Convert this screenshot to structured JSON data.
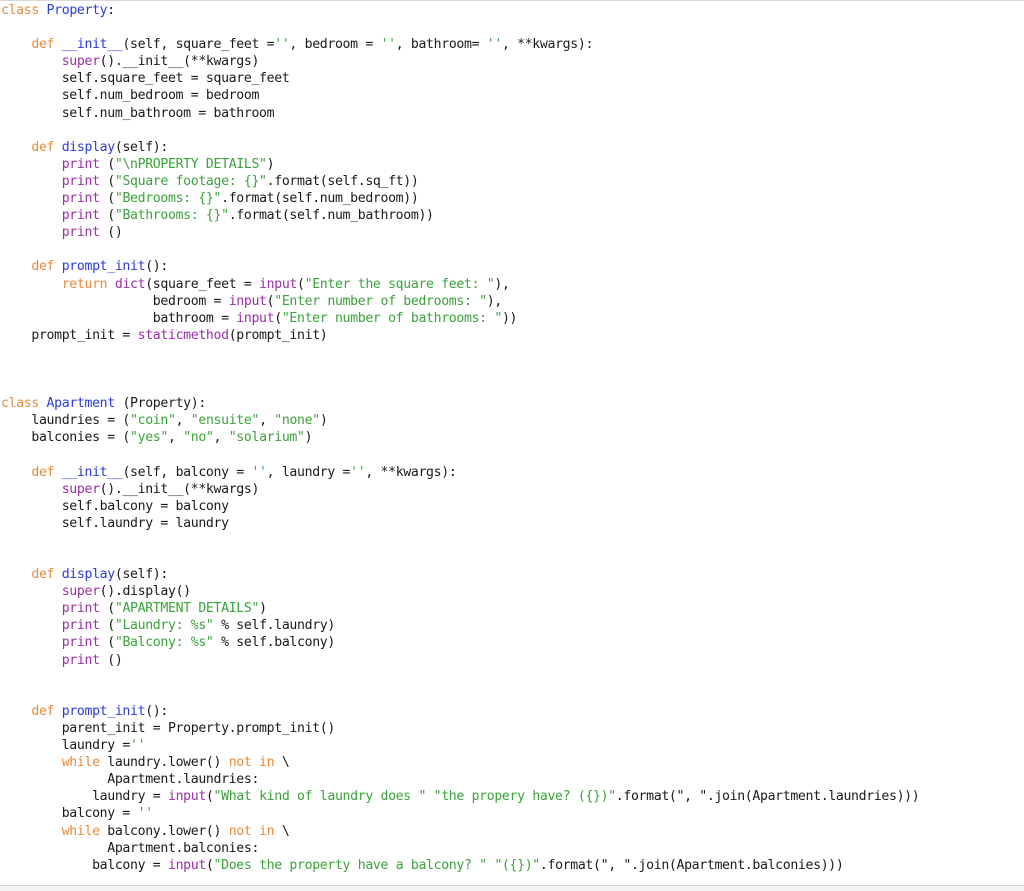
{
  "editor": {
    "language": "python",
    "colors": {
      "keyword": "#e88a3c",
      "function_name": "#2a3bd6",
      "builtin": "#9a2fa8",
      "string": "#3aa33a",
      "text": "#1a1a1a",
      "background": "#ffffff"
    },
    "lines": [
      [
        [
          "kw",
          "class "
        ],
        [
          "fn",
          "Property"
        ],
        [
          "tx",
          ":"
        ]
      ],
      [],
      [
        [
          "tx",
          "    "
        ],
        [
          "kw",
          "def "
        ],
        [
          "fn",
          "__init__"
        ],
        [
          "tx",
          "(self, square_feet ="
        ],
        [
          "st",
          "''"
        ],
        [
          "tx",
          ", bedroom = "
        ],
        [
          "st",
          "''"
        ],
        [
          "tx",
          ", bathroom= "
        ],
        [
          "st",
          "''"
        ],
        [
          "tx",
          ", **kwargs):"
        ]
      ],
      [
        [
          "tx",
          "        "
        ],
        [
          "bi",
          "super"
        ],
        [
          "tx",
          "().__init__(**kwargs)"
        ]
      ],
      [
        [
          "tx",
          "        self.square_feet = square_feet"
        ]
      ],
      [
        [
          "tx",
          "        self.num_bedroom = bedroom"
        ]
      ],
      [
        [
          "tx",
          "        self.num_bathroom = bathroom"
        ]
      ],
      [],
      [
        [
          "tx",
          "    "
        ],
        [
          "kw",
          "def "
        ],
        [
          "fn",
          "display"
        ],
        [
          "tx",
          "(self):"
        ]
      ],
      [
        [
          "tx",
          "        "
        ],
        [
          "bi",
          "print"
        ],
        [
          "tx",
          " ("
        ],
        [
          "st",
          "\"\\nPROPERTY DETAILS\""
        ],
        [
          "tx",
          ")"
        ]
      ],
      [
        [
          "tx",
          "        "
        ],
        [
          "bi",
          "print"
        ],
        [
          "tx",
          " ("
        ],
        [
          "st",
          "\"Square footage: {}\""
        ],
        [
          "tx",
          ".format(self.sq_ft))"
        ]
      ],
      [
        [
          "tx",
          "        "
        ],
        [
          "bi",
          "print"
        ],
        [
          "tx",
          " ("
        ],
        [
          "st",
          "\"Bedrooms: {}\""
        ],
        [
          "tx",
          ".format(self.num_bedroom))"
        ]
      ],
      [
        [
          "tx",
          "        "
        ],
        [
          "bi",
          "print"
        ],
        [
          "tx",
          " ("
        ],
        [
          "st",
          "\"Bathrooms: {}\""
        ],
        [
          "tx",
          ".format(self.num_bathroom))"
        ]
      ],
      [
        [
          "tx",
          "        "
        ],
        [
          "bi",
          "print"
        ],
        [
          "tx",
          " ()"
        ]
      ],
      [],
      [
        [
          "tx",
          "    "
        ],
        [
          "kw",
          "def "
        ],
        [
          "fn",
          "prompt_init"
        ],
        [
          "tx",
          "():"
        ]
      ],
      [
        [
          "tx",
          "        "
        ],
        [
          "kw",
          "return "
        ],
        [
          "bi",
          "dict"
        ],
        [
          "tx",
          "(square_feet = "
        ],
        [
          "bi",
          "input"
        ],
        [
          "tx",
          "("
        ],
        [
          "st",
          "\"Enter the square feet: \""
        ],
        [
          "tx",
          "),"
        ]
      ],
      [
        [
          "tx",
          "                    bedroom = "
        ],
        [
          "bi",
          "input"
        ],
        [
          "tx",
          "("
        ],
        [
          "st",
          "\"Enter number of bedrooms: \""
        ],
        [
          "tx",
          "),"
        ]
      ],
      [
        [
          "tx",
          "                    bathroom = "
        ],
        [
          "bi",
          "input"
        ],
        [
          "tx",
          "("
        ],
        [
          "st",
          "\"Enter number of bathrooms: \""
        ],
        [
          "tx",
          "))"
        ]
      ],
      [
        [
          "tx",
          "    prompt_init = "
        ],
        [
          "bi",
          "staticmethod"
        ],
        [
          "tx",
          "(prompt_init)"
        ]
      ],
      [],
      [],
      [],
      [
        [
          "kw",
          "class "
        ],
        [
          "fn",
          "Apartment"
        ],
        [
          "tx",
          " (Property):"
        ]
      ],
      [
        [
          "tx",
          "    laundries = ("
        ],
        [
          "st",
          "\"coin\""
        ],
        [
          "tx",
          ", "
        ],
        [
          "st",
          "\"ensuite\""
        ],
        [
          "tx",
          ", "
        ],
        [
          "st",
          "\"none\""
        ],
        [
          "tx",
          ")"
        ]
      ],
      [
        [
          "tx",
          "    balconies = ("
        ],
        [
          "st",
          "\"yes\""
        ],
        [
          "tx",
          ", "
        ],
        [
          "st",
          "\"no\""
        ],
        [
          "tx",
          ", "
        ],
        [
          "st",
          "\"solarium\""
        ],
        [
          "tx",
          ")"
        ]
      ],
      [],
      [
        [
          "tx",
          "    "
        ],
        [
          "kw",
          "def "
        ],
        [
          "fn",
          "__init__"
        ],
        [
          "tx",
          "(self, balcony = "
        ],
        [
          "st",
          "''"
        ],
        [
          "tx",
          ", laundry ="
        ],
        [
          "st",
          "''"
        ],
        [
          "tx",
          ", **kwargs):"
        ]
      ],
      [
        [
          "tx",
          "        "
        ],
        [
          "bi",
          "super"
        ],
        [
          "tx",
          "().__init__(**kwargs)"
        ]
      ],
      [
        [
          "tx",
          "        self.balcony = balcony"
        ]
      ],
      [
        [
          "tx",
          "        self.laundry = laundry"
        ]
      ],
      [],
      [],
      [
        [
          "tx",
          "    "
        ],
        [
          "kw",
          "def "
        ],
        [
          "fn",
          "display"
        ],
        [
          "tx",
          "(self):"
        ]
      ],
      [
        [
          "tx",
          "        "
        ],
        [
          "bi",
          "super"
        ],
        [
          "tx",
          "().display()"
        ]
      ],
      [
        [
          "tx",
          "        "
        ],
        [
          "bi",
          "print"
        ],
        [
          "tx",
          " ("
        ],
        [
          "st",
          "\"APARTMENT DETAILS\""
        ],
        [
          "tx",
          ")"
        ]
      ],
      [
        [
          "tx",
          "        "
        ],
        [
          "bi",
          "print"
        ],
        [
          "tx",
          " ("
        ],
        [
          "st",
          "\"Laundry: %s\""
        ],
        [
          "tx",
          " % self.laundry)"
        ]
      ],
      [
        [
          "tx",
          "        "
        ],
        [
          "bi",
          "print"
        ],
        [
          "tx",
          " ("
        ],
        [
          "st",
          "\"Balcony: %s\""
        ],
        [
          "tx",
          " % self.balcony)"
        ]
      ],
      [
        [
          "tx",
          "        "
        ],
        [
          "bi",
          "print"
        ],
        [
          "tx",
          " ()"
        ]
      ],
      [],
      [],
      [
        [
          "tx",
          "    "
        ],
        [
          "kw",
          "def "
        ],
        [
          "fn",
          "prompt_init"
        ],
        [
          "tx",
          "():"
        ]
      ],
      [
        [
          "tx",
          "        parent_init = Property.prompt_init()"
        ]
      ],
      [
        [
          "tx",
          "        laundry ="
        ],
        [
          "st",
          "''"
        ]
      ],
      [
        [
          "tx",
          "        "
        ],
        [
          "kw",
          "while"
        ],
        [
          "tx",
          " laundry.lower() "
        ],
        [
          "kw",
          "not in"
        ],
        [
          "tx",
          " \\"
        ]
      ],
      [
        [
          "tx",
          "              Apartment.laundries:"
        ]
      ],
      [
        [
          "tx",
          "            laundry = "
        ],
        [
          "bi",
          "input"
        ],
        [
          "tx",
          "("
        ],
        [
          "st",
          "\"What kind of laundry does \" \"the propery have? ({})\""
        ],
        [
          "tx",
          ".format(\", \".join(Apartment.laundries)))"
        ]
      ],
      [
        [
          "tx",
          "        balcony = "
        ],
        [
          "st",
          "''"
        ]
      ],
      [
        [
          "tx",
          "        "
        ],
        [
          "kw",
          "while"
        ],
        [
          "tx",
          " balcony.lower() "
        ],
        [
          "kw",
          "not in"
        ],
        [
          "tx",
          " \\"
        ]
      ],
      [
        [
          "tx",
          "              Apartment.balconies:"
        ]
      ],
      [
        [
          "tx",
          "            balcony = "
        ],
        [
          "bi",
          "input"
        ],
        [
          "tx",
          "("
        ],
        [
          "st",
          "\"Does the property have a balcony? \" \"({})\""
        ],
        [
          "tx",
          ".format(\", \".join(Apartment.balconies)))"
        ]
      ]
    ]
  }
}
